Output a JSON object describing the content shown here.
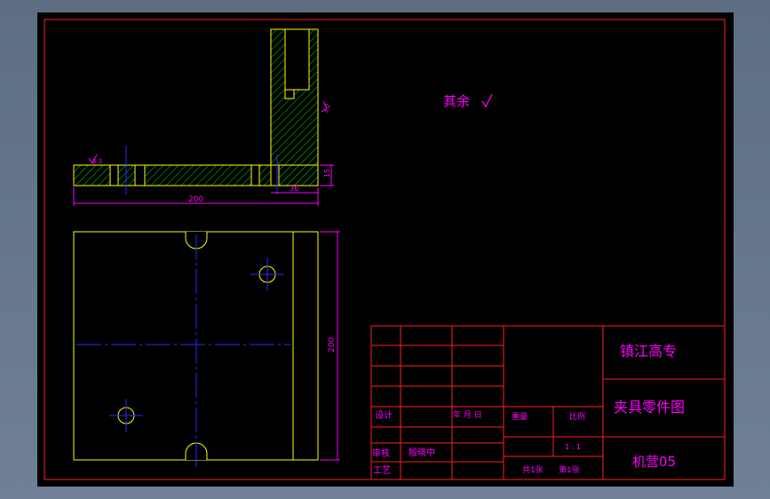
{
  "drawing": {
    "roughness_note_label": "其余",
    "roughness_mark_left": "6.3",
    "roughness_mark_right": "3.2",
    "dim_length": "200",
    "dim_width": "36",
    "dim_thickness": "15",
    "dim_height": "200"
  },
  "title_block": {
    "school": "镇江高专",
    "part_name": "夹具零件图",
    "class_name": "机营05",
    "design_label": "设计",
    "review_label": "审核",
    "process_label": "工艺",
    "designer": "殷晓中",
    "date_label": "年  月  日",
    "weight_label": "重量",
    "scale_label": "比例",
    "scale_value": "1 : 1",
    "sheets_total": "共1张",
    "sheet_no": "第1张"
  },
  "colors": {
    "frame": "#ff2020",
    "outline": "#ffff00",
    "hatch": "#00e000",
    "centerline": "#2a2aff",
    "dimension": "#ff00ff",
    "title_text": "#ff00ff",
    "viewport_bg": "#000000"
  }
}
